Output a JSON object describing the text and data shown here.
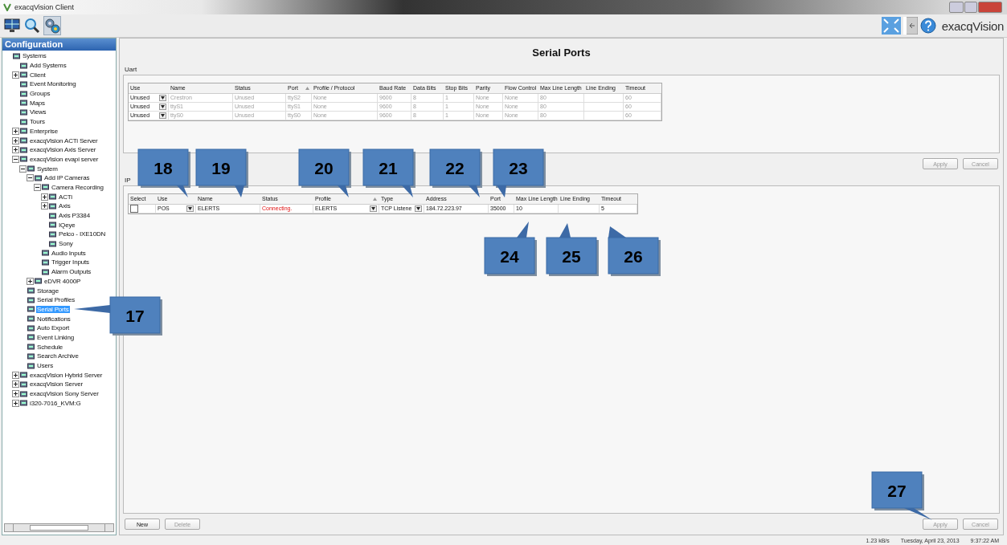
{
  "window": {
    "title": "exacqVision Client"
  },
  "toolbar": [
    {
      "kind": "monitor",
      "selected": false
    },
    {
      "kind": "search",
      "selected": false
    },
    {
      "kind": "config",
      "selected": true
    }
  ],
  "logo": "exacqVision",
  "sidebar": {
    "title": "Configuration",
    "tree": [
      {
        "label": "Systems",
        "selected": false,
        "children": [
          {
            "label": "Add Systems",
            "selected": false
          },
          {
            "label": "Client",
            "selected": false,
            "expanded": false
          },
          {
            "label": "Event Monitoring",
            "selected": false
          },
          {
            "label": "Groups",
            "selected": false
          },
          {
            "label": "Maps",
            "selected": false
          },
          {
            "label": "Views",
            "selected": false
          },
          {
            "label": "Tours",
            "selected": false
          },
          {
            "label": "Enterprise",
            "selected": false,
            "expanded": false
          },
          {
            "label": "exacqVision ACTi Server",
            "selected": false,
            "expanded": false
          },
          {
            "label": "exacqVision Axis Server",
            "selected": false,
            "expanded": false
          },
          {
            "label": "exacqVision evapi server",
            "selected": false,
            "expanded": true,
            "children": [
              {
                "label": "System",
                "selected": false,
                "expanded": true,
                "children": [
                  {
                    "label": "Add IP Cameras",
                    "selected": false,
                    "expanded": true,
                    "children": [
                      {
                        "label": "Camera Recording",
                        "selected": false,
                        "expanded": true,
                        "children": [
                          {
                            "label": "ACTi",
                            "selected": false,
                            "expanded": false
                          },
                          {
                            "label": "Axis",
                            "selected": false,
                            "expanded": false
                          },
                          {
                            "label": "Axis P3384",
                            "selected": false
                          },
                          {
                            "label": "IQeye",
                            "selected": false
                          },
                          {
                            "label": "Pelco - IXE10DN",
                            "selected": false
                          },
                          {
                            "label": "Sony",
                            "selected": false
                          }
                        ]
                      },
                      {
                        "label": "Audio Inputs",
                        "selected": false
                      },
                      {
                        "label": "Trigger Inputs",
                        "selected": false
                      },
                      {
                        "label": "Alarm Outputs",
                        "selected": false
                      }
                    ]
                  },
                  {
                    "label": "eDVR 4000P",
                    "selected": false,
                    "expanded": false
                  }
                ]
              },
              {
                "label": "Storage",
                "selected": false
              },
              {
                "label": "Serial Profiles",
                "selected": false
              },
              {
                "label": "Serial Ports",
                "selected": true
              },
              {
                "label": "Notifications",
                "selected": false
              },
              {
                "label": "Auto Export",
                "selected": false
              },
              {
                "label": "Event Linking",
                "selected": false
              },
              {
                "label": "Schedule",
                "selected": false
              },
              {
                "label": "Search Archive",
                "selected": false
              },
              {
                "label": "Users",
                "selected": false
              }
            ]
          },
          {
            "label": "exacqVision Hybrid Server",
            "selected": false,
            "expanded": false
          },
          {
            "label": "exacqVision Server",
            "selected": false,
            "expanded": false
          },
          {
            "label": "exacqVision Sony Server",
            "selected": false,
            "expanded": false
          },
          {
            "label": "i320-7016_KVM:G",
            "selected": false,
            "expanded": false
          }
        ]
      }
    ]
  },
  "page_title": "Serial Ports",
  "uart": {
    "label": "Uart",
    "columns": [
      {
        "label": "Use"
      },
      {
        "label": "Name"
      },
      {
        "label": "Status"
      },
      {
        "label": "Port",
        "sorted": true
      },
      {
        "label": "Profile / Protocol"
      },
      {
        "label": "Baud Rate"
      },
      {
        "label": "Data Bits"
      },
      {
        "label": "Stop Bits"
      },
      {
        "label": "Parity"
      },
      {
        "label": "Flow Control"
      },
      {
        "label": "Max Line Length"
      },
      {
        "label": "Line Ending"
      },
      {
        "label": "Timeout"
      }
    ],
    "rows": [
      {
        "disabled": true,
        "cells": [
          "Unused",
          "Crestron",
          "Unused",
          "ttyS2",
          "None",
          "9600",
          "8",
          "1",
          "None",
          "None",
          "80",
          "",
          "60"
        ]
      },
      {
        "disabled": true,
        "cells": [
          "Unused",
          "ttyS1",
          "Unused",
          "ttyS1",
          "None",
          "9600",
          "8",
          "1",
          "None",
          "None",
          "80",
          "",
          "60"
        ]
      },
      {
        "disabled": true,
        "cells": [
          "Unused",
          "ttyS0",
          "Unused",
          "ttyS0",
          "None",
          "9600",
          "8",
          "1",
          "None",
          "None",
          "80",
          "",
          "60"
        ]
      }
    ],
    "buttons": [
      {
        "label": "Apply",
        "disabled": true
      },
      {
        "label": "Cancel",
        "disabled": true
      }
    ]
  },
  "ip": {
    "label": "IP",
    "columns": [
      {
        "label": "Select"
      },
      {
        "label": "Use"
      },
      {
        "label": "Name"
      },
      {
        "label": "Status"
      },
      {
        "label": "Profile",
        "sorted": true
      },
      {
        "label": "Type"
      },
      {
        "label": "Address"
      },
      {
        "label": "Port"
      },
      {
        "label": "Max Line Length"
      },
      {
        "label": "Line Ending"
      },
      {
        "label": "Timeout"
      }
    ],
    "rows": [
      {
        "checked": false,
        "use": "POS",
        "name": "ELERTS",
        "status": "Connecting.",
        "status_error": true,
        "profile": "ELERTS",
        "type": "TCP Listene",
        "address": "184.72.223.97",
        "port": "35000",
        "max_line_length": "10",
        "timeout": "5"
      }
    ],
    "left_buttons": [
      {
        "label": "New",
        "disabled": false
      },
      {
        "label": "Delete",
        "disabled": true
      }
    ],
    "buttons": [
      {
        "label": "Apply",
        "disabled": true
      },
      {
        "label": "Cancel",
        "disabled": true
      }
    ]
  },
  "callouts": [
    "18",
    "19",
    "20",
    "21",
    "22",
    "23",
    "24",
    "25",
    "26",
    "17",
    "27"
  ],
  "status_bar": {
    "rate": "1.23 kB/s",
    "date": "Tuesday, April 23, 2013",
    "time": "9:37:22 AM"
  }
}
